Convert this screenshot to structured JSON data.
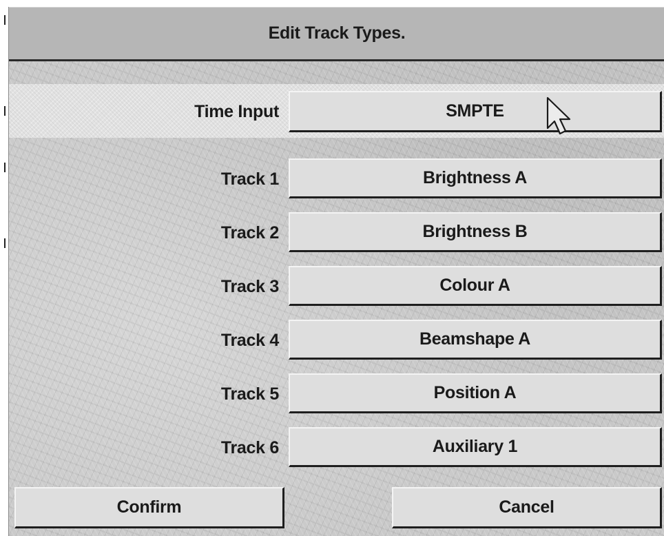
{
  "dialog": {
    "title": "Edit Track Types."
  },
  "time_input": {
    "label": "Time Input",
    "value": "SMPTE"
  },
  "tracks": [
    {
      "label": "Track 1",
      "value": "Brightness A"
    },
    {
      "label": "Track 2",
      "value": "Brightness B"
    },
    {
      "label": "Track 3",
      "value": "Colour A"
    },
    {
      "label": "Track 4",
      "value": "Beamshape A"
    },
    {
      "label": "Track 5",
      "value": "Position A"
    },
    {
      "label": "Track 6",
      "value": "Auxiliary 1"
    }
  ],
  "actions": {
    "confirm_label": "Confirm",
    "cancel_label": "Cancel"
  },
  "colors": {
    "title_bar": "#b6b6b6",
    "button_face": "#dedede",
    "text": "#1a1a1a",
    "background": "#c9c9c9"
  }
}
